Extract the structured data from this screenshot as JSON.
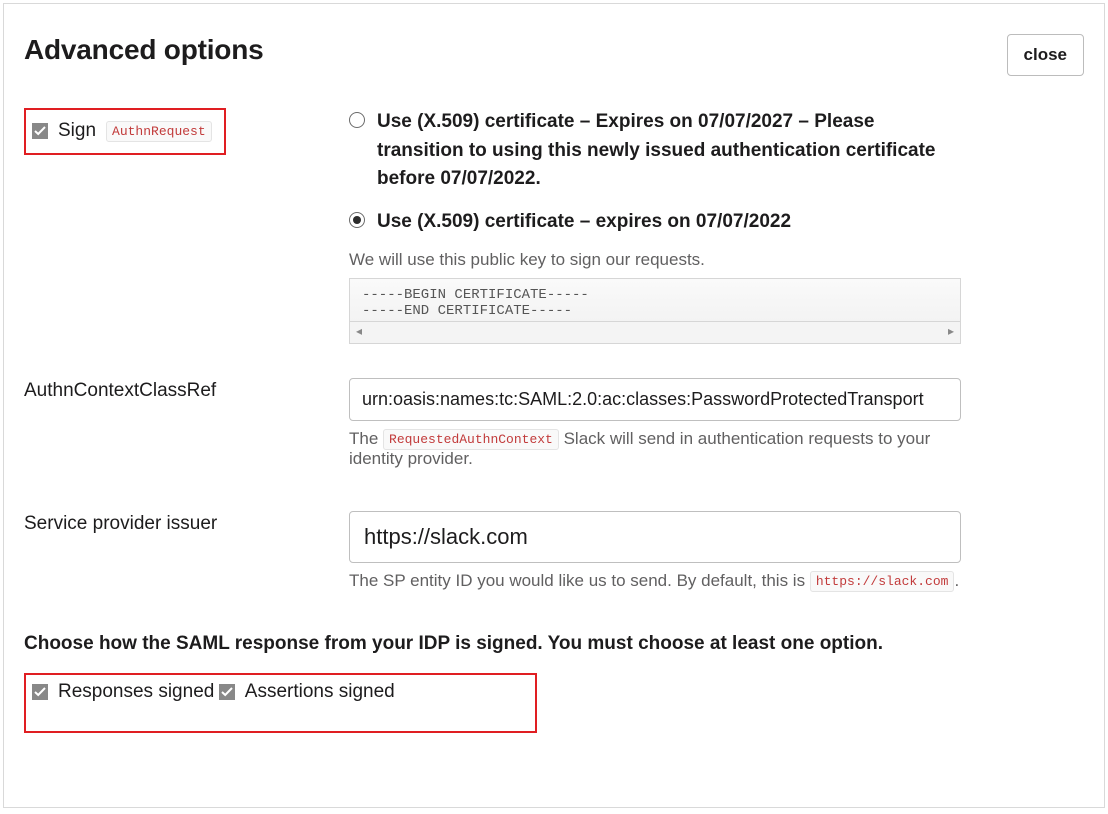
{
  "header": {
    "title": "Advanced options",
    "close_label": "close"
  },
  "sign": {
    "label": "Sign",
    "code": "AuthnRequest"
  },
  "cert": {
    "option1": "Use (X.509) certificate – Expires on 07/07/2027 – Please transition to using this newly issued authentication certificate before 07/07/2022.",
    "option2": "Use (X.509) certificate – expires on 07/07/2022",
    "help": "We will use this public key to sign our requests.",
    "pem": "-----BEGIN CERTIFICATE-----\n-----END CERTIFICATE-----"
  },
  "authn": {
    "label": "AuthnContextClassRef",
    "value": "urn:oasis:names:tc:SAML:2.0:ac:classes:PasswordProtectedTransport",
    "help_pre": "The ",
    "help_code": "RequestedAuthnContext",
    "help_post": " Slack will send in authentication requests to your identity provider."
  },
  "sp": {
    "label": "Service provider issuer",
    "value": "https://slack.com",
    "help_pre": "The SP entity ID you would like us to send. By default, this is ",
    "help_code": "https://slack.com",
    "help_post": "."
  },
  "signing": {
    "instruction": "Choose how the SAML response from your IDP is signed. You must choose at least one option.",
    "responses_label": "Responses signed",
    "assertions_label": "Assertions signed"
  }
}
